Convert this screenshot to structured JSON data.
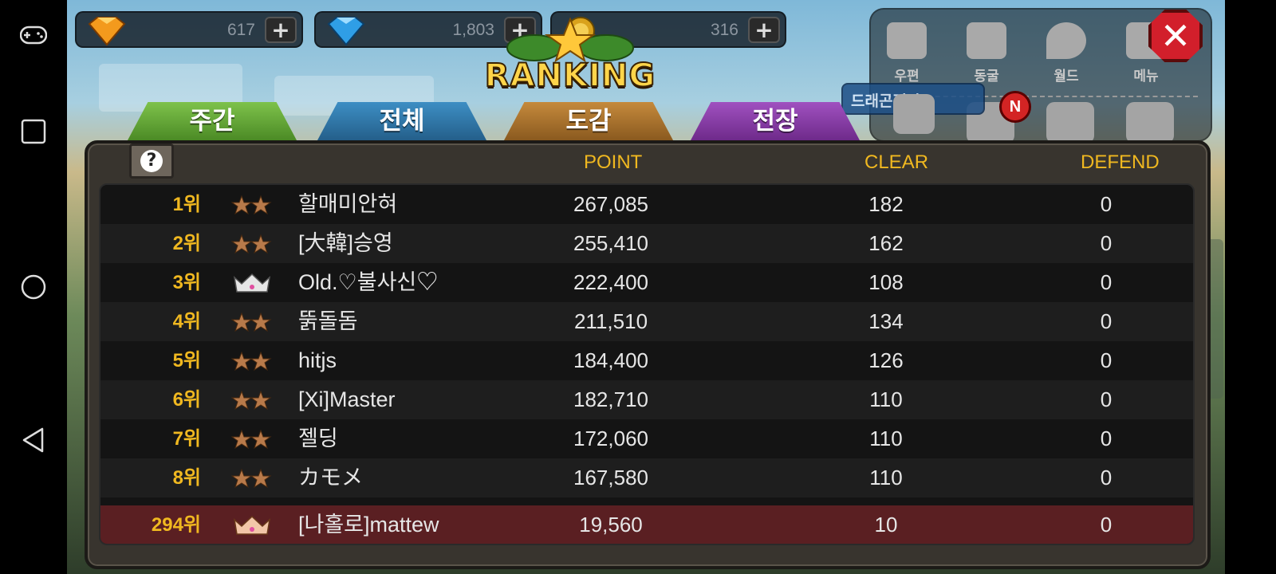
{
  "currencies": [
    {
      "icon": "orange-gem-icon",
      "value": "617"
    },
    {
      "icon": "blue-gem-icon",
      "value": "1,803"
    },
    {
      "icon": "gold-coin-icon",
      "value": "316"
    }
  ],
  "plus_label": "+",
  "logo_title": "RANKING",
  "top_menu": [
    {
      "icon": "mail-icon",
      "label": "우편"
    },
    {
      "icon": "cave-icon",
      "label": "동굴"
    },
    {
      "icon": "world-pin-icon",
      "label": "월드"
    },
    {
      "icon": "menu-book-icon",
      "label": "메뉴"
    }
  ],
  "new_badge": "N",
  "dragon_button": "드래곤전장",
  "close_label": "✕",
  "tabs": {
    "weekly": "주간",
    "all": "전체",
    "book": "도감",
    "battle": "전장"
  },
  "help_label": "?",
  "columns": {
    "point": "POINT",
    "clear": "CLEAR",
    "defend": "DEFEND"
  },
  "rows": [
    {
      "rank": "1위",
      "badge": "star",
      "name": "할매미안혀",
      "point": "267,085",
      "clear": "182",
      "defend": "0"
    },
    {
      "rank": "2위",
      "badge": "star",
      "name": "[大韓]승영",
      "point": "255,410",
      "clear": "162",
      "defend": "0"
    },
    {
      "rank": "3위",
      "badge": "crown-silver",
      "name": "Old.♡불사신♡",
      "point": "222,400",
      "clear": "108",
      "defend": "0"
    },
    {
      "rank": "4위",
      "badge": "star",
      "name": "뚥돌돔",
      "point": "211,510",
      "clear": "134",
      "defend": "0"
    },
    {
      "rank": "5위",
      "badge": "star",
      "name": "hitjs",
      "point": "184,400",
      "clear": "126",
      "defend": "0"
    },
    {
      "rank": "6위",
      "badge": "star",
      "name": "[Xi]Master",
      "point": "182,710",
      "clear": "110",
      "defend": "0"
    },
    {
      "rank": "7위",
      "badge": "star",
      "name": "젤딩",
      "point": "172,060",
      "clear": "110",
      "defend": "0"
    },
    {
      "rank": "8위",
      "badge": "star",
      "name": "カモメ",
      "point": "167,580",
      "clear": "110",
      "defend": "0"
    }
  ],
  "my_row": {
    "rank": "294위",
    "badge": "crown-bronze",
    "name": "[나홀로]mattew",
    "point": "19,560",
    "clear": "10",
    "defend": "0"
  },
  "colors": {
    "accent_gold": "#f0b820",
    "my_row_bg": "#5a1f22",
    "close_red": "#d21f2b"
  }
}
